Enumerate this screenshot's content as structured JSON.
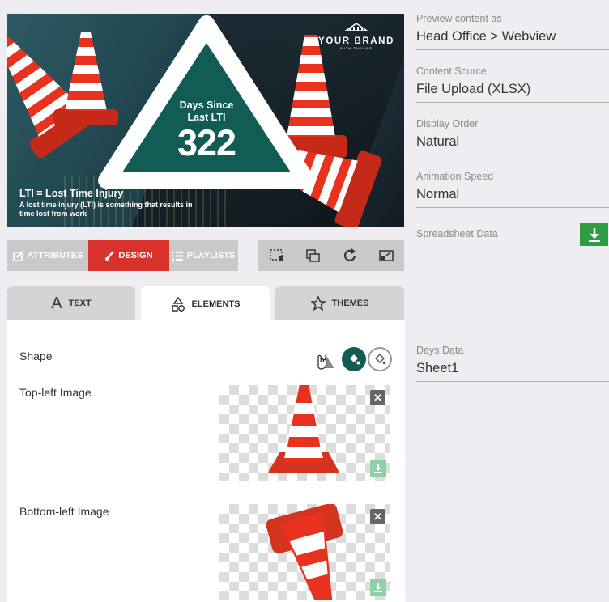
{
  "preview": {
    "brand": "YOUR BRAND",
    "brand_tagline": "WITH TAGLINE",
    "sign_line1": "Days Since",
    "sign_line2": "Last LTI",
    "days_count": "322",
    "lti_heading": "LTI = Lost Time Injury",
    "lti_description": "A lost time injury (LTI) is something that results in time lost from work"
  },
  "toolbar": {
    "tabs": [
      {
        "label": "ATTRIBUTES",
        "icon": "edit-icon"
      },
      {
        "label": "DESIGN",
        "icon": "brush-icon",
        "active": true
      },
      {
        "label": "PLAYLISTS",
        "icon": "list-icon"
      }
    ],
    "tools": [
      "select-area-icon",
      "layers-icon",
      "refresh-icon",
      "resize-icon"
    ]
  },
  "editor": {
    "tabs": [
      {
        "label": "TEXT",
        "icon": "text-icon"
      },
      {
        "label": "ELEMENTS",
        "icon": "shapes-icon",
        "active": true
      },
      {
        "label": "THEMES",
        "icon": "star-icon"
      }
    ],
    "shape_label": "Shape",
    "top_left_image_label": "Top-left Image",
    "bottom_left_image_label": "Bottom-left Image",
    "remove_symbol": "✕"
  },
  "settings": {
    "preview_as_label": "Preview content as",
    "preview_as_value": "Head Office > Webview",
    "content_source_label": "Content Source",
    "content_source_value": "File Upload (XLSX)",
    "display_order_label": "Display Order",
    "display_order_value": "Natural",
    "animation_speed_label": "Animation Speed",
    "animation_speed_value": "Normal",
    "spreadsheet_data_label": "Spreadsheet Data",
    "days_data_label": "Days Data",
    "days_data_value": "Sheet1"
  },
  "colors": {
    "accent_red": "#d9312b",
    "teal": "#115c55",
    "download_green": "#2e9c43"
  }
}
